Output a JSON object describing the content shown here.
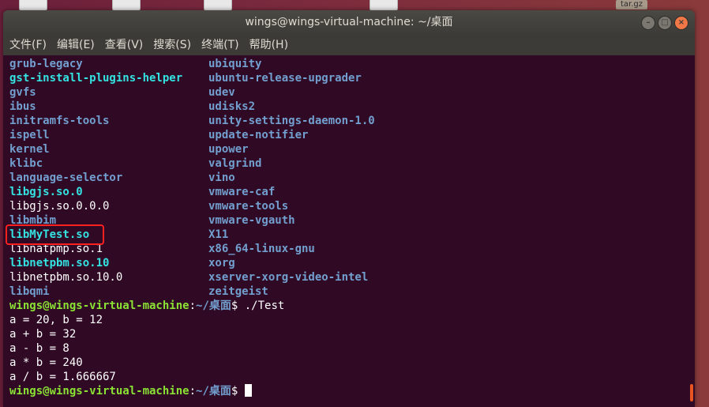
{
  "desktop": {
    "label_tar": "tar.gz"
  },
  "window": {
    "title": "wings@wings-virtual-machine: ~/桌面",
    "controls": {
      "minimize": "–",
      "maximize": "□",
      "close": "×"
    }
  },
  "menu": {
    "items": [
      "文件(F)",
      "编辑(E)",
      "查看(V)",
      "搜索(S)",
      "终端(T)",
      "帮助(H)"
    ]
  },
  "listing": {
    "left": [
      {
        "name": "grub-legacy",
        "type": "dir"
      },
      {
        "name": "gst-install-plugins-helper",
        "type": "link"
      },
      {
        "name": "gvfs",
        "type": "dir"
      },
      {
        "name": "ibus",
        "type": "dir"
      },
      {
        "name": "initramfs-tools",
        "type": "dir"
      },
      {
        "name": "ispell",
        "type": "dir"
      },
      {
        "name": "kernel",
        "type": "dir"
      },
      {
        "name": "klibc",
        "type": "dir"
      },
      {
        "name": "language-selector",
        "type": "dir"
      },
      {
        "name": "libgjs.so.0",
        "type": "link"
      },
      {
        "name": "libgjs.so.0.0.0",
        "type": "plain"
      },
      {
        "name": "libmbim",
        "type": "dir"
      },
      {
        "name": "libMyTest.so",
        "type": "link"
      },
      {
        "name": "libnatpmp.so.1",
        "type": "plain"
      },
      {
        "name": "libnetpbm.so.10",
        "type": "link"
      },
      {
        "name": "libnetpbm.so.10.0",
        "type": "plain"
      },
      {
        "name": "libqmi",
        "type": "dir"
      }
    ],
    "right": [
      {
        "name": "ubiquity",
        "type": "dir"
      },
      {
        "name": "ubuntu-release-upgrader",
        "type": "dir"
      },
      {
        "name": "udev",
        "type": "dir"
      },
      {
        "name": "udisks2",
        "type": "dir"
      },
      {
        "name": "unity-settings-daemon-1.0",
        "type": "dir"
      },
      {
        "name": "update-notifier",
        "type": "dir"
      },
      {
        "name": "upower",
        "type": "dir"
      },
      {
        "name": "valgrind",
        "type": "dir"
      },
      {
        "name": "vino",
        "type": "dir"
      },
      {
        "name": "vmware-caf",
        "type": "dir"
      },
      {
        "name": "vmware-tools",
        "type": "dir"
      },
      {
        "name": "vmware-vgauth",
        "type": "dir"
      },
      {
        "name": "X11",
        "type": "dir"
      },
      {
        "name": "x86_64-linux-gnu",
        "type": "dir"
      },
      {
        "name": "xorg",
        "type": "dir"
      },
      {
        "name": "xserver-xorg-video-intel",
        "type": "dir"
      },
      {
        "name": "zeitgeist",
        "type": "dir"
      }
    ]
  },
  "session": {
    "prompt_user": "wings@wings-virtual-machine",
    "prompt_sep": ":",
    "prompt_path": "~/桌面",
    "prompt_end": "$ ",
    "command": "./Test",
    "output": [
      "a = 20, b = 12",
      "a + b = 32",
      "a - b = 8",
      "a * b = 240",
      "a / b = 1.666667"
    ]
  },
  "colors": {
    "terminal_bg": "#300a24",
    "dir": "#729fcf",
    "link": "#34e2e2",
    "prompt_user": "#8ae234",
    "highlight": "#ff2020",
    "scroll_accent": "#e95420"
  }
}
